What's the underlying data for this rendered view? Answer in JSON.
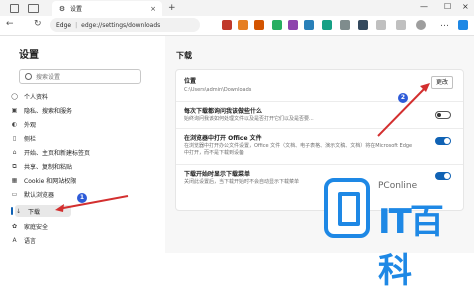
{
  "tab": {
    "title": "设置"
  },
  "address": {
    "brand": "Edge",
    "url": "edge://settings/downloads"
  },
  "sidebar": {
    "title": "设置",
    "search_placeholder": "搜索设置",
    "items": [
      {
        "label": "个人资料",
        "icon": "profile-icon"
      },
      {
        "label": "隐私、搜索和服务",
        "icon": "lock-icon"
      },
      {
        "label": "外观",
        "icon": "appearance-icon"
      },
      {
        "label": "侧栏",
        "icon": "sidebar-icon"
      },
      {
        "label": "开始、主页和新建标签页",
        "icon": "home-icon"
      },
      {
        "label": "共享、复制和粘贴",
        "icon": "share-icon"
      },
      {
        "label": "Cookie 和网站权限",
        "icon": "cookie-icon"
      },
      {
        "label": "默认浏览器",
        "icon": "browser-icon"
      },
      {
        "label": "下载",
        "icon": "download-icon"
      },
      {
        "label": "家庭安全",
        "icon": "family-icon"
      },
      {
        "label": "语言",
        "icon": "language-icon"
      }
    ]
  },
  "main": {
    "title": "下载",
    "location": {
      "title": "位置",
      "path": "C:\\Users\\admin\\Downloads",
      "button": "更改"
    },
    "ask": {
      "title": "每次下载都询问我该做些什么",
      "desc": "始终询问我该如何处理文件以及是否打开它们以及是否要...",
      "enabled": false
    },
    "office": {
      "title": "在浏览器中打开 Office 文件",
      "desc": "在浏览器中打开办公文件设置，Office 文件（文档、电子表格、演示文稿、文档）将在Microsoft Edge中打开，而不是下载到设备",
      "enabled": true
    },
    "menu": {
      "title": "下载开始时显示下载菜单",
      "desc": "关闭此设置后，当下载开始时不会自动显示下载菜单",
      "enabled": true
    }
  },
  "annotations": {
    "badge1": "1",
    "badge2": "2",
    "arrow_color": "#d32f2f"
  },
  "watermark": {
    "site": "PConline",
    "brand": "IT百科"
  },
  "colors": {
    "accent": "#1062b4",
    "watermark": "#1e88e5"
  }
}
